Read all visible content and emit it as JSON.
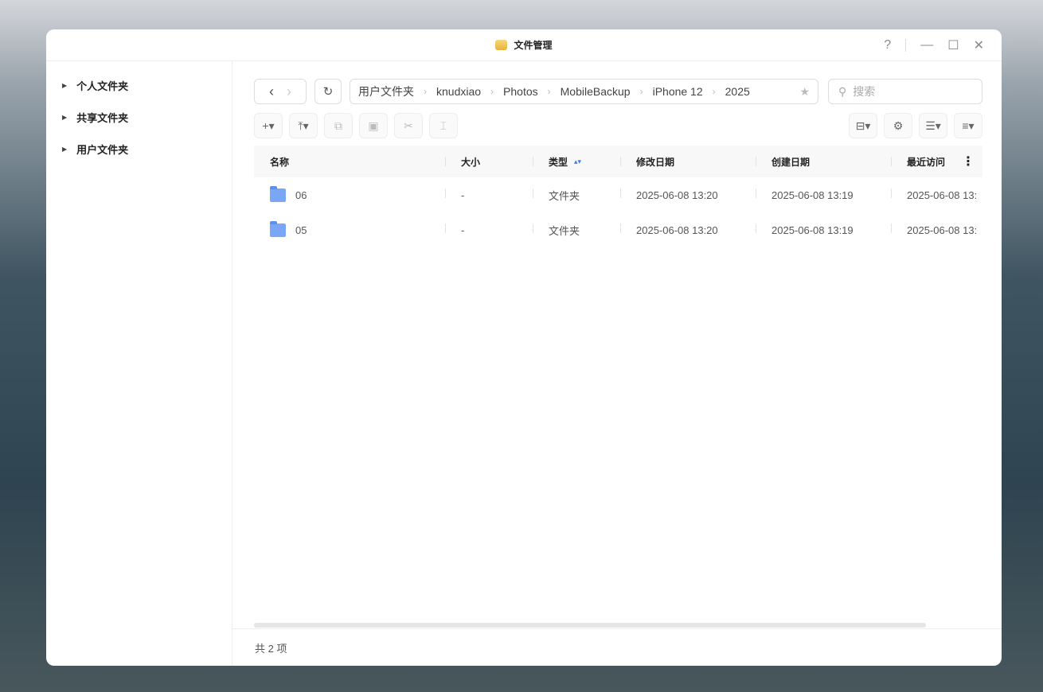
{
  "window": {
    "title": "文件管理",
    "help": "?",
    "minimize": "—",
    "maximize": "☐",
    "close": "✕"
  },
  "sidebar": {
    "items": [
      {
        "label": "个人文件夹"
      },
      {
        "label": "共享文件夹"
      },
      {
        "label": "用户文件夹"
      }
    ]
  },
  "nav": {
    "back": "‹",
    "forward": "›",
    "refresh": "↻"
  },
  "breadcrumb": [
    "用户文件夹",
    "knudxiao",
    "Photos",
    "MobileBackup",
    "iPhone 12",
    "2025"
  ],
  "search": {
    "placeholder": "搜索"
  },
  "table": {
    "columns": [
      "名称",
      "大小",
      "类型",
      "修改日期",
      "创建日期",
      "最近访问"
    ],
    "rows": [
      {
        "name": "06",
        "size": "-",
        "type": "文件夹",
        "modified": "2025-06-08 13:20",
        "created": "2025-06-08 13:19",
        "accessed": "2025-06-08 13:"
      },
      {
        "name": "05",
        "size": "-",
        "type": "文件夹",
        "modified": "2025-06-08 13:20",
        "created": "2025-06-08 13:19",
        "accessed": "2025-06-08 13:"
      }
    ]
  },
  "footer": {
    "count": "共 2 项"
  }
}
